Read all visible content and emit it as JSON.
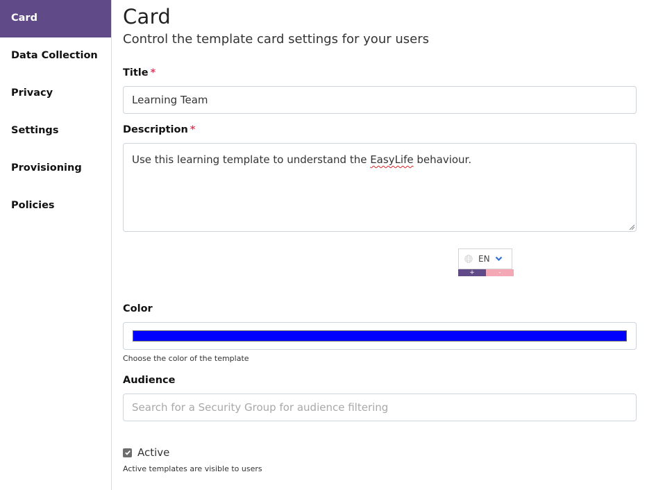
{
  "sidebar": {
    "items": [
      {
        "label": "Card",
        "active": true
      },
      {
        "label": "Data Collection",
        "active": false
      },
      {
        "label": "Privacy",
        "active": false
      },
      {
        "label": "Settings",
        "active": false
      },
      {
        "label": "Provisioning",
        "active": false
      },
      {
        "label": "Policies",
        "active": false
      }
    ]
  },
  "header": {
    "title": "Card",
    "subtitle": "Control the template card settings for your users"
  },
  "form": {
    "title": {
      "label": "Title",
      "required_mark": "*",
      "value": "Learning Team"
    },
    "description": {
      "label": "Description",
      "required_mark": "*",
      "value_before": "Use this learning template to understand the ",
      "value_misspelled": "EasyLife",
      "value_after": " behaviour."
    },
    "language": {
      "icon": "globe-icon",
      "selected": "EN",
      "add_label": "+",
      "remove_label": "-"
    },
    "color": {
      "label": "Color",
      "value": "#0000ff",
      "help": "Choose the color of the template"
    },
    "audience": {
      "label": "Audience",
      "value": "",
      "placeholder": "Search for a Security Group for audience filtering"
    },
    "active": {
      "label": "Active",
      "checked": true,
      "help": "Active templates are visible to users"
    }
  },
  "colors": {
    "accent": "#604a87",
    "required": "#e0405f",
    "remove": "#f4a7b5",
    "chevron": "#2f6fd6"
  }
}
